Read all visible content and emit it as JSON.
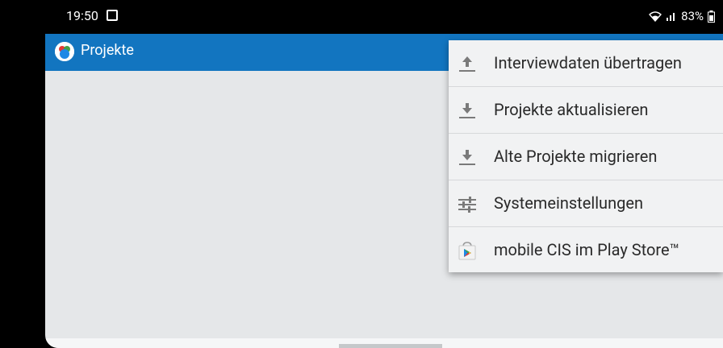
{
  "status_bar": {
    "time": "19:50",
    "battery": "83%"
  },
  "app_bar": {
    "title": "Projekte"
  },
  "menu": {
    "items": [
      {
        "label": "Interviewdaten übertragen",
        "icon": "upload-icon"
      },
      {
        "label": "Projekte aktualisieren",
        "icon": "download-icon"
      },
      {
        "label": "Alte Projekte migrieren",
        "icon": "download-icon"
      },
      {
        "label": "Systemeinstellungen",
        "icon": "sliders-icon"
      },
      {
        "label": "mobile CIS im Play Store™",
        "icon": "play-store-icon"
      }
    ]
  },
  "colors": {
    "app_bar": "#1275c0",
    "background": "#e5e7e9",
    "menu": "#f1f2f3"
  }
}
